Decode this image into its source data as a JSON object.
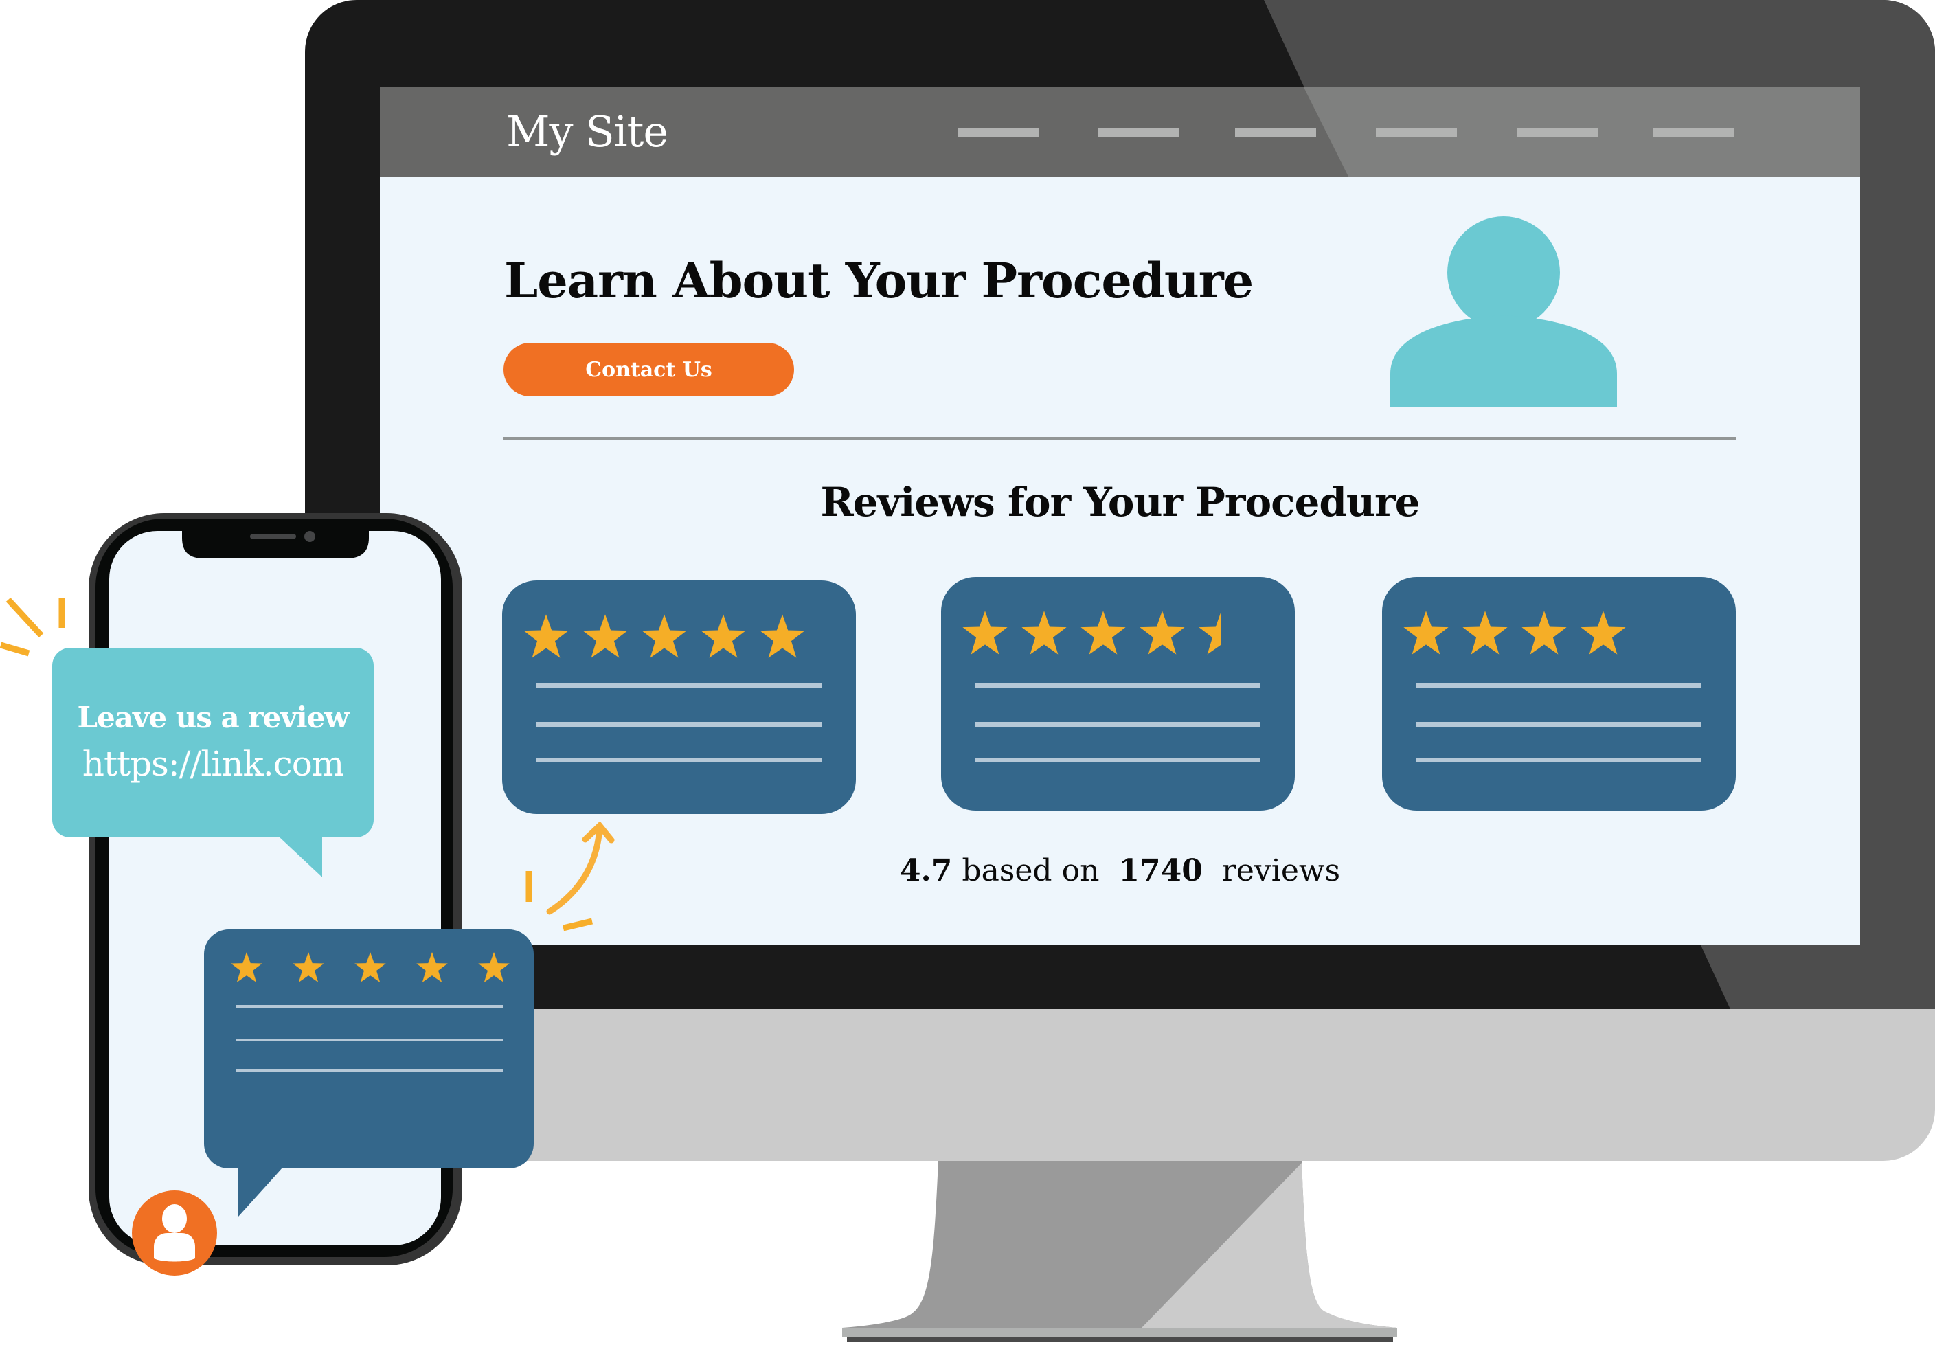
{
  "colors": {
    "accent_orange": "#f07023",
    "teal": "#6bc9d2",
    "card_blue": "#34678b",
    "star_gold": "#f5ae27",
    "screen_bg": "#eef6fc",
    "header_gray": "#676766",
    "bezel": "#1a1a1a"
  },
  "site": {
    "title": "My Site",
    "nav_items": [
      "nav-1",
      "nav-2",
      "nav-3",
      "nav-4",
      "nav-5",
      "nav-6"
    ]
  },
  "hero": {
    "title": "Learn About Your Procedure",
    "cta_label": "Contact Us",
    "avatar_icon": "user-silhouette-icon"
  },
  "reviews": {
    "title": "Reviews for Your Procedure",
    "cards": [
      {
        "rating": 5,
        "max": 5,
        "text_lines": 3
      },
      {
        "rating": 4.5,
        "max": 5,
        "text_lines": 3
      },
      {
        "rating": 4,
        "max": 5,
        "text_lines": 3
      }
    ],
    "summary": {
      "average": "4.7",
      "based_on_label": "based on",
      "count": "1740",
      "reviews_label": "reviews"
    }
  },
  "phone": {
    "message": {
      "line1": "Leave us a review",
      "line2": "https://link.com"
    },
    "review_bubble": {
      "rating": 5,
      "max": 5,
      "text_lines": 3
    },
    "user_icon": "user-avatar-icon"
  }
}
